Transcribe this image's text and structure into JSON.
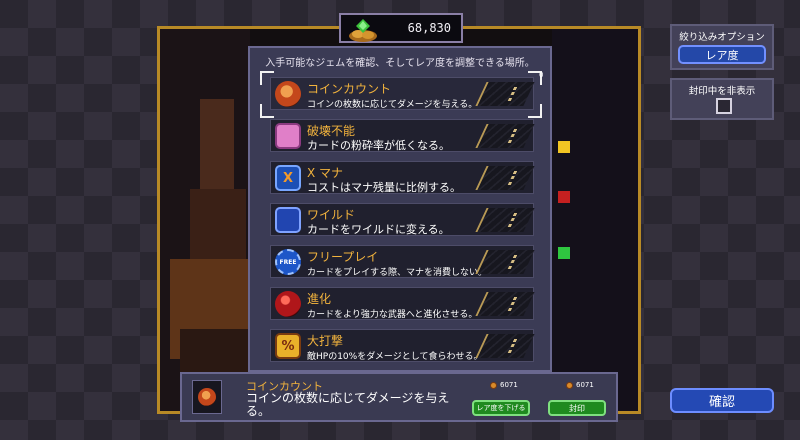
{
  "currency": {
    "amount": "68,830",
    "icon": "gem-coin-bag-icon"
  },
  "panel": {
    "description": "入手可能なジェムを確認、そしてレア度を調整できる場所。",
    "counter": "0"
  },
  "gems": [
    {
      "name": "コインカウント",
      "desc": "コインの枚数に応じてダメージを与える。",
      "icon": "coin-icon",
      "icon_label": ""
    },
    {
      "name": "破壊不能",
      "desc": "カードの粉砕率が低くなる。",
      "icon": "broken-card-icon",
      "icon_label": ""
    },
    {
      "name": "X マナ",
      "desc": "コストはマナ残量に比例する。",
      "icon": "x-mana-icon",
      "icon_label": "X"
    },
    {
      "name": "ワイルド",
      "desc": "カードをワイルドに変える。",
      "icon": "wild-icon",
      "icon_label": ""
    },
    {
      "name": "フリープレイ",
      "desc": "カードをプレイする際、マナを消費しない。",
      "icon": "free-play-icon",
      "icon_label": "FREE"
    },
    {
      "name": "進化",
      "desc": "カードをより強力な武器へと進化させる。",
      "icon": "evolve-orb-icon",
      "icon_label": ""
    },
    {
      "name": "大打撃",
      "desc": "敵HPの10%をダメージとして食らわせる。",
      "icon": "percent-icon",
      "icon_label": "%"
    }
  ],
  "filter": {
    "title": "絞り込みオプション",
    "button": "レア度"
  },
  "hide_sealed": {
    "title": "封印中を非表示"
  },
  "confirm": "確認",
  "detail": {
    "name": "コインカウント",
    "desc": "コインの枚数に応じてダメージを与える。",
    "cost_left": "6071",
    "cost_right": "6071",
    "lower_rarity": "レア度を下げる",
    "seal": "封印"
  },
  "colors": {
    "accent_gold": "#f2b33d",
    "button_blue": "#2449b4",
    "button_green": "#1f8a1f",
    "frame_gold": "#b88a26"
  }
}
